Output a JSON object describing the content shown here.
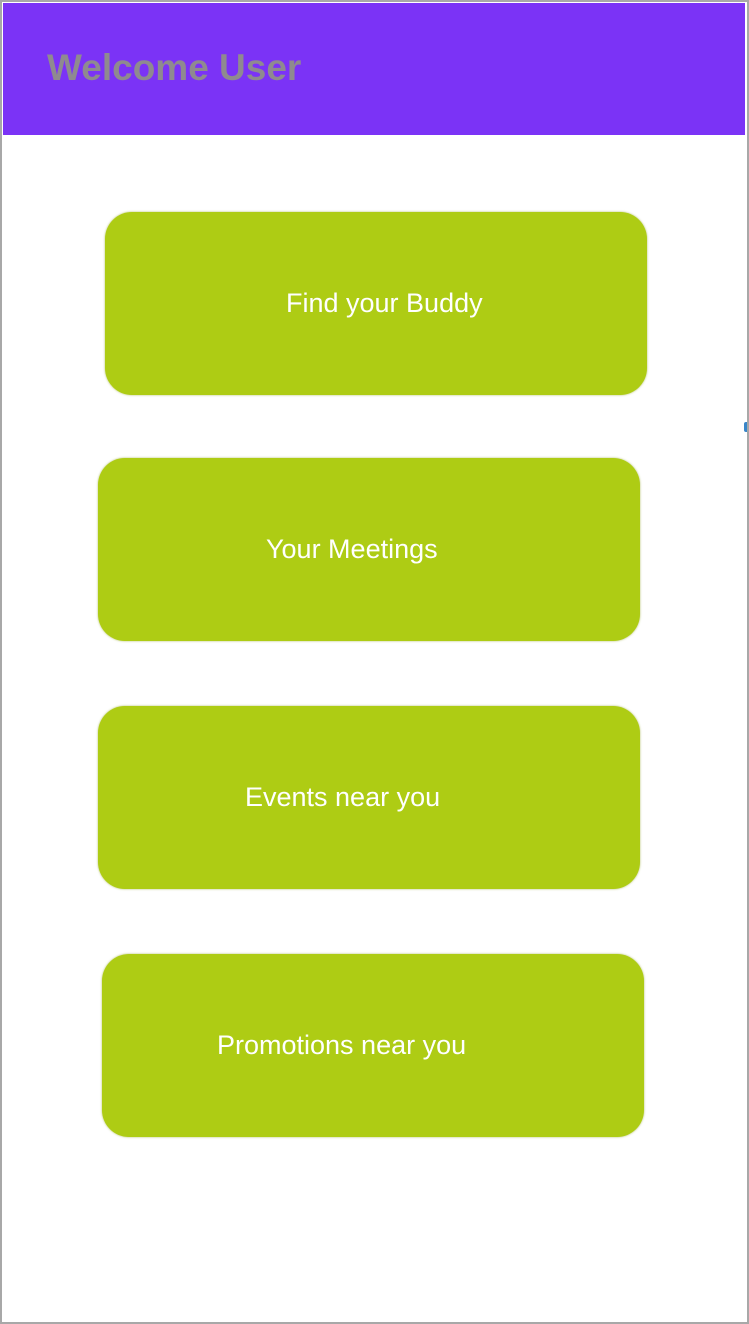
{
  "header": {
    "title": "Welcome User"
  },
  "menu": {
    "buttons": [
      {
        "label": "Find your Buddy"
      },
      {
        "label": "Your Meetings"
      },
      {
        "label": "Events near you"
      },
      {
        "label": "Promotions near you"
      }
    ]
  },
  "colors": {
    "header_background": "#7b33f6",
    "header_text": "#8f8a8f",
    "button_background": "#aecc14",
    "button_text": "#ffffff",
    "page_background": "#ffffff"
  }
}
